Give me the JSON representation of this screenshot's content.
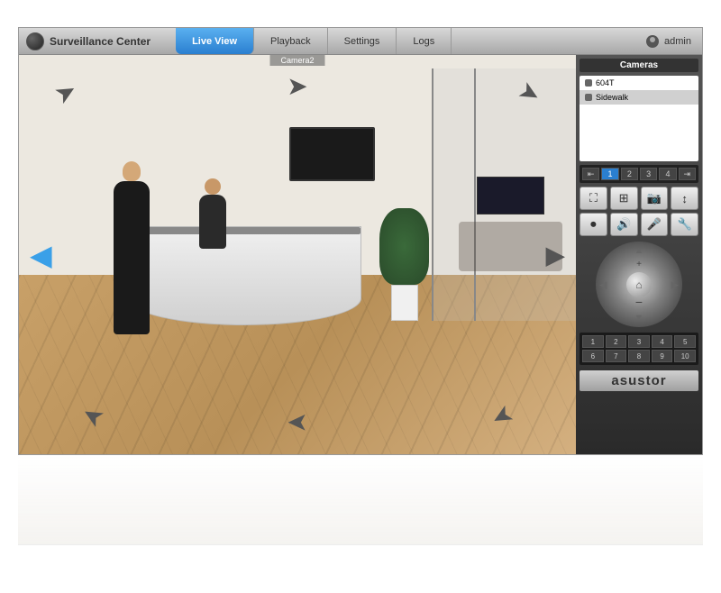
{
  "app": {
    "title": "Surveillance Center"
  },
  "tabs": {
    "live_view": "Live View",
    "playback": "Playback",
    "settings": "Settings",
    "logs": "Logs"
  },
  "user": {
    "name": "admin"
  },
  "viewport": {
    "camera_label": "Camera2"
  },
  "panel": {
    "header": "Cameras",
    "cameras": [
      {
        "name": "604T"
      },
      {
        "name": "Sidewalk"
      }
    ],
    "layouts": [
      "⇤",
      "1",
      "2",
      "3",
      "4",
      "⇥"
    ],
    "active_layout_index": 1,
    "controls": [
      {
        "icon": "⛶",
        "name": "fullscreen"
      },
      {
        "icon": "⊞",
        "name": "grid-view"
      },
      {
        "icon": "📷",
        "name": "snapshot"
      },
      {
        "icon": "↕",
        "name": "stretch"
      },
      {
        "icon": "⏺",
        "name": "record"
      },
      {
        "icon": "🔊",
        "name": "audio"
      },
      {
        "icon": "🎤",
        "name": "mic"
      },
      {
        "icon": "🔧",
        "name": "settings"
      }
    ],
    "presets": [
      "1",
      "2",
      "3",
      "4",
      "5",
      "6",
      "7",
      "8",
      "9",
      "10"
    ],
    "brand": "asustor"
  }
}
